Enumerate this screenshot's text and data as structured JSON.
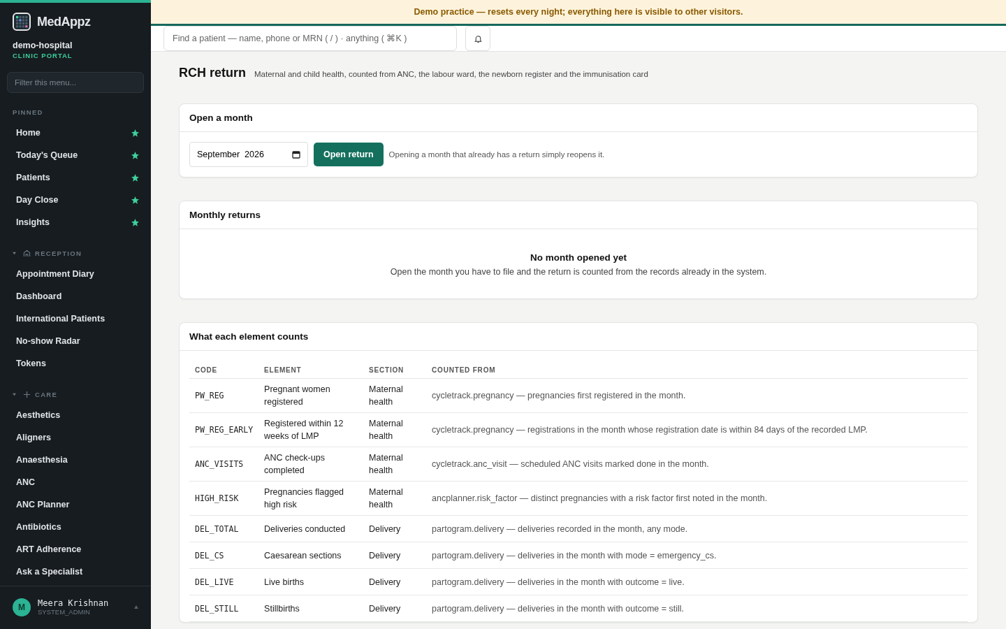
{
  "sidebar": {
    "brand": "MedAppz",
    "org": "demo-hospital",
    "portal": "CLINIC PORTAL",
    "filter": {
      "placeholder": "Filter this menu..."
    },
    "groups": [
      {
        "kind": "pinned",
        "label": "PINNED",
        "items": [
          {
            "label": "Home",
            "pinned": true
          },
          {
            "label": "Today's Queue",
            "pinned": true
          },
          {
            "label": "Patients",
            "pinned": true
          },
          {
            "label": "Day Close",
            "pinned": true
          },
          {
            "label": "Insights",
            "pinned": true
          }
        ]
      },
      {
        "kind": "reception",
        "label": "RECEPTION",
        "expanded": true,
        "items": [
          {
            "label": "Appointment Diary"
          },
          {
            "label": "Dashboard"
          },
          {
            "label": "International Patients"
          },
          {
            "label": "No-show Radar"
          },
          {
            "label": "Tokens"
          }
        ]
      },
      {
        "kind": "care",
        "label": "CARE",
        "expanded": true,
        "items": [
          {
            "label": "Aesthetics"
          },
          {
            "label": "Aligners"
          },
          {
            "label": "Anaesthesia"
          },
          {
            "label": "ANC"
          },
          {
            "label": "ANC Planner"
          },
          {
            "label": "Antibiotics"
          },
          {
            "label": "ART Adherence"
          },
          {
            "label": "Ask a Specialist"
          }
        ]
      }
    ],
    "user": {
      "initial": "M",
      "name": "Meera Krishnan",
      "role": "SYSTEM_ADMIN"
    }
  },
  "banner": "Demo practice — resets every night; everything here is visible to other visitors.",
  "search": {
    "placeholder": "Find a patient — name, phone or MRN ( / ) · anything ( ⌘K )"
  },
  "page": {
    "title": "RCH return",
    "subtitle": "Maternal and child health, counted from ANC, the labour ward, the newborn register and the immunisation card"
  },
  "open_month": {
    "title": "Open a month",
    "month": "September  2026",
    "button": "Open return",
    "note": "Opening a month that already has a return simply reopens it."
  },
  "monthly_returns": {
    "title": "Monthly returns",
    "empty_title": "No month opened yet",
    "empty_text": "Open the month you have to file and the return is counted from the records already in the system."
  },
  "elements": {
    "title": "What each element counts",
    "columns": [
      "CODE",
      "ELEMENT",
      "SECTION",
      "COUNTED FROM"
    ],
    "rows": [
      [
        "PW_REG",
        "Pregnant women registered",
        "Maternal health",
        "cycletrack.pregnancy — pregnancies first registered in the month."
      ],
      [
        "PW_REG_EARLY",
        "Registered within 12 weeks of LMP",
        "Maternal health",
        "cycletrack.pregnancy — registrations in the month whose registration date is within 84 days of the recorded LMP."
      ],
      [
        "ANC_VISITS",
        "ANC check-ups completed",
        "Maternal health",
        "cycletrack.anc_visit — scheduled ANC visits marked done in the month."
      ],
      [
        "HIGH_RISK",
        "Pregnancies flagged high risk",
        "Maternal health",
        "ancplanner.risk_factor — distinct pregnancies with a risk factor first noted in the month."
      ],
      [
        "DEL_TOTAL",
        "Deliveries conducted",
        "Delivery",
        "partogram.delivery — deliveries recorded in the month, any mode."
      ],
      [
        "DEL_CS",
        "Caesarean sections",
        "Delivery",
        "partogram.delivery — deliveries in the month with mode = emergency_cs."
      ],
      [
        "DEL_LIVE",
        "Live births",
        "Delivery",
        "partogram.delivery — deliveries in the month with outcome = live."
      ],
      [
        "DEL_STILL",
        "Stillbirths",
        "Delivery",
        "partogram.delivery — deliveries in the month with outcome = still."
      ]
    ]
  }
}
